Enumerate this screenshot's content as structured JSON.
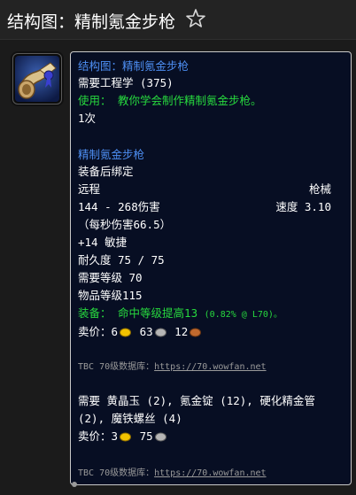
{
  "page": {
    "title": "结构图：精制氪金步枪"
  },
  "recipe": {
    "name": "结构图：精制氪金步枪",
    "requires_skill": "需要工程学 (375)",
    "use_label": "使用：",
    "use_text": "教你学会制作精制氪金步枪。",
    "charges": "1次"
  },
  "item": {
    "name": "精制氪金步枪",
    "bind": "装备后绑定",
    "slot": "远程",
    "type": "枪械",
    "damage": "144 - 268伤害",
    "speed": "速度 3.10",
    "dps": "（每秒伤害66.5）",
    "stat": "+14 敏捷",
    "durability": "耐久度 75 / 75",
    "required_level": "需要等级 70",
    "item_level": "物品等级115",
    "equip_label": "装备：",
    "equip_text": "命中等级提高13",
    "equip_note": "(0.82% @ L70)。",
    "sell_label": "卖价：",
    "sell_gold": "6",
    "sell_silver": "63",
    "sell_copper": "12"
  },
  "source_label": "TBC 70级数据库：",
  "source_url": "https://70.wowfan.net",
  "reagents": {
    "line1": "需要 黄晶玉 (2), 氪金锭 (12), 硬化精金管",
    "line2": "(2), 魔铁螺丝 (4)",
    "sell_label": "卖价：",
    "sell_gold": "3",
    "sell_silver": "75"
  },
  "colors": {
    "tooltip_bg": "#070e23",
    "name_blue": "#4d8ef2",
    "use_green": "#27d93e",
    "gold": "#f2c200",
    "silver": "#b5b5b5",
    "copper": "#c0692e"
  },
  "icons": {
    "favorite": "star-outline-icon",
    "item": "scroll-schematic-icon"
  }
}
